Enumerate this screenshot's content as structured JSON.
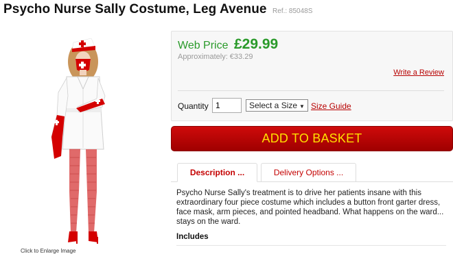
{
  "product": {
    "title": "Psycho Nurse Sally Costume, Leg Avenue",
    "ref": "Ref.: 85048S",
    "image_alt": "Psycho nurse costume model",
    "thumb_caption": "Click to Enlarge Image"
  },
  "pricing": {
    "web_price_label": "Web Price",
    "web_price": "£29.99",
    "approx": "Approximately: €33.29",
    "review_link": "Write a Review",
    "price_color": "#2a9a2a"
  },
  "purchase": {
    "quantity_label": "Quantity",
    "quantity_value": "1",
    "size_select": "Select a Size",
    "size_guide": "Size Guide",
    "basket_button": "ADD TO BASKET",
    "button_color": "#c00000",
    "button_text_color": "#ffe000"
  },
  "tabs": [
    {
      "label": "Description ...",
      "active": true
    },
    {
      "label": "Delivery Options ...",
      "active": false
    }
  ],
  "description": {
    "text": "Psycho Nurse Sally's treatment is to drive her patients insane with this extraordinary four piece costume which includes a button front garter dress, face mask, arm pieces, and pointed headband. What happens on the ward... stays on the ward.",
    "includes_heading": "Includes"
  }
}
